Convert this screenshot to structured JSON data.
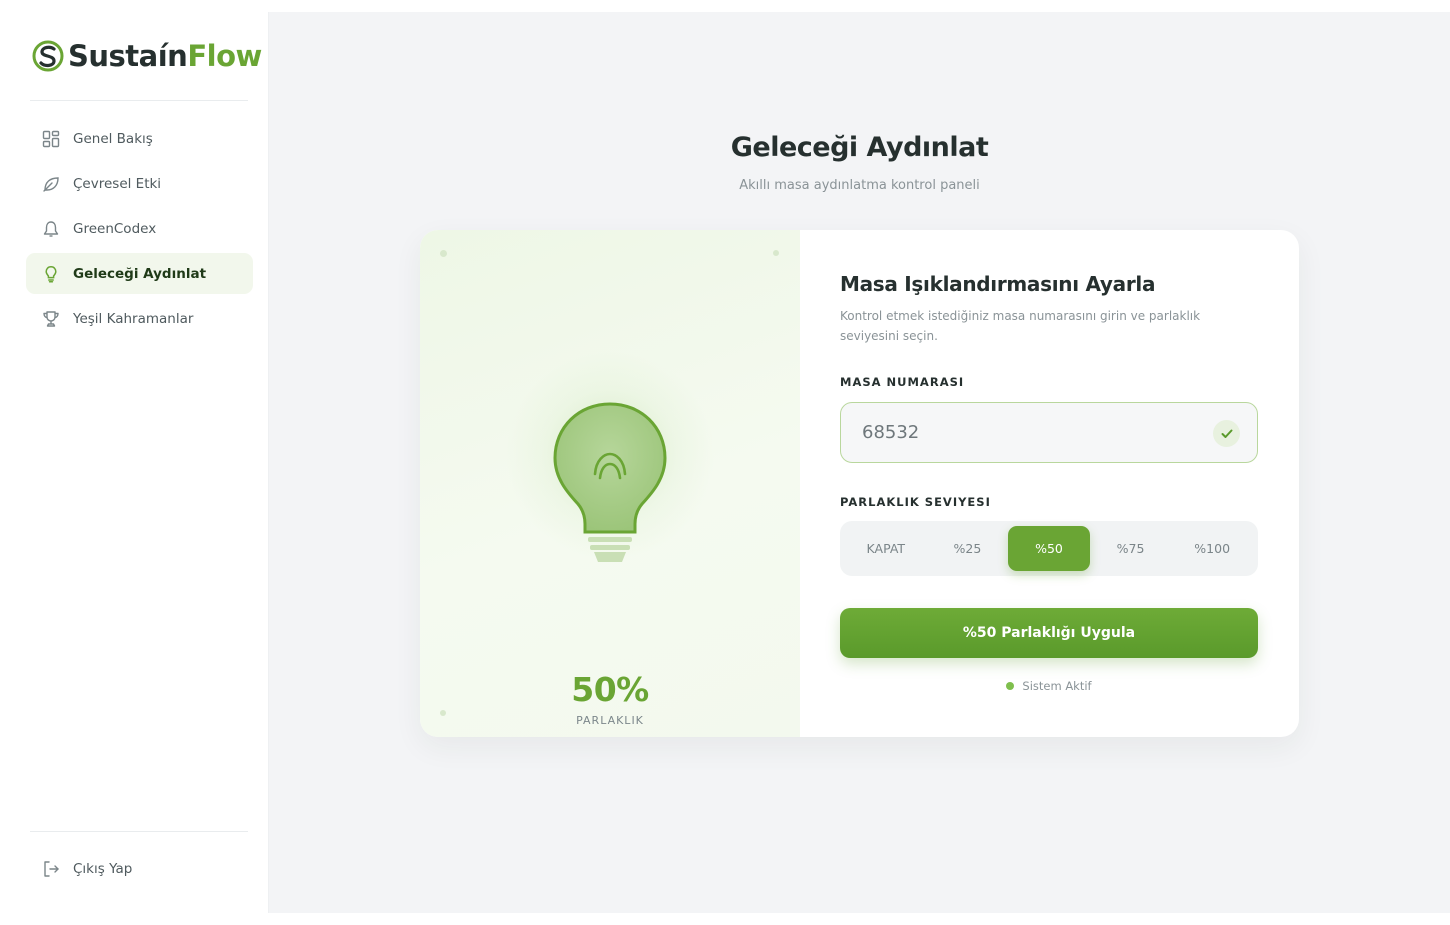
{
  "brand": {
    "name_part1": "Sustaín",
    "name_part2": "Flow"
  },
  "sidebar": {
    "items": [
      {
        "label": "Genel Bakış",
        "icon": "grid-icon"
      },
      {
        "label": "Çevresel Etki",
        "icon": "leaf-icon"
      },
      {
        "label": "GreenCodex",
        "icon": "bell-icon"
      },
      {
        "label": "Geleceği Aydınlat",
        "icon": "lightbulb-icon",
        "active": true
      },
      {
        "label": "Yeşil Kahramanlar",
        "icon": "trophy-icon"
      }
    ],
    "logout_label": "Çıkış Yap"
  },
  "main": {
    "title": "Geleceği Aydınlat",
    "subtitle": "Akıllı masa aydınlatma kontrol paneli"
  },
  "preview": {
    "brightness_value": "50%",
    "brightness_label": "PARLAKLIK",
    "brightness_level": 0.5
  },
  "form": {
    "title": "Masa Işıklandırmasını Ayarla",
    "description": "Kontrol etmek istediğiniz masa numarasını girin ve parlaklık seviyesini seçin.",
    "desk_label": "MASA NUMARASI",
    "desk_value": "68532",
    "brightness_label": "PARLAKLIK SEVIYESI",
    "options": [
      "KAPAT",
      "%25",
      "%50",
      "%75",
      "%100"
    ],
    "selected_option": "%50",
    "apply_label": "%50 Parlaklığı Uygula",
    "status_label": "Sistem Aktif"
  },
  "colors": {
    "accent": "#6aa534",
    "accent_dark": "#5a9a2b",
    "text_dark": "#26302f",
    "muted": "#8a9397",
    "background": "#f3f4f6"
  }
}
